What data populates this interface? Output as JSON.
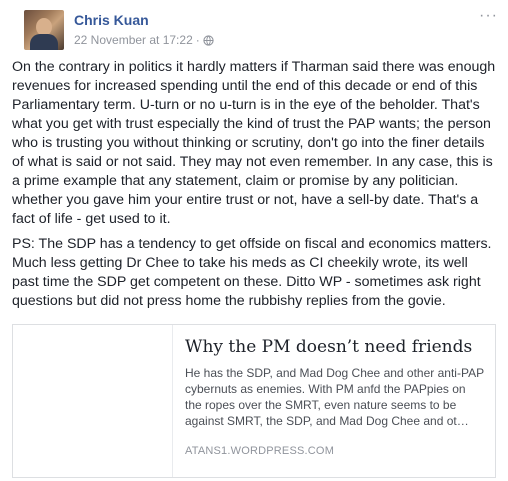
{
  "post": {
    "author": "Chris Kuan",
    "timestamp": "22 November at 17:22",
    "separator": "·",
    "privacy_icon": "globe-icon",
    "more_icon": "more-options-icon",
    "paragraphs": [
      "On the contrary in politics it hardly matters if Tharman said there was enough revenues for increased spending until the end of this decade or end of this Parliamentary term. U-turn or no u-turn is in the eye of the beholder. That's what you get with trust especially the kind of trust the PAP wants; the person who is trusting you without thinking or scrutiny, don't go into the finer details of what is said or not said. They may not even remember. In any case, this is a prime example that any statement, claim or promise by any politician. whether you gave him your entire trust or not, have a sell-by date. That's a fact of life - get used to it.",
      "PS: The SDP has a tendency to get offside on fiscal and economics matters. Much less getting Dr Chee to take his meds as CI cheekily wrote, its well past time the SDP get competent on these. Ditto WP - sometimes ask right questions but did not press home the rubbishy replies from the govie."
    ]
  },
  "link_card": {
    "title": "Why the PM doesn’t need friends",
    "description": "He has the SDP, and Mad Dog Chee and other anti-PAP cybernuts as enemies. With PM anfd the PAPpies on the ropes over the SMRT, even nature seems to be against SMRT, the SDP, and Mad Dog Chee and ot…",
    "domain": "ATANS1.WORDPRESS.COM"
  },
  "colors": {
    "author_link": "#365899",
    "meta_text": "#90949c",
    "body_text": "#1d2129",
    "card_border": "#dddfe2"
  }
}
